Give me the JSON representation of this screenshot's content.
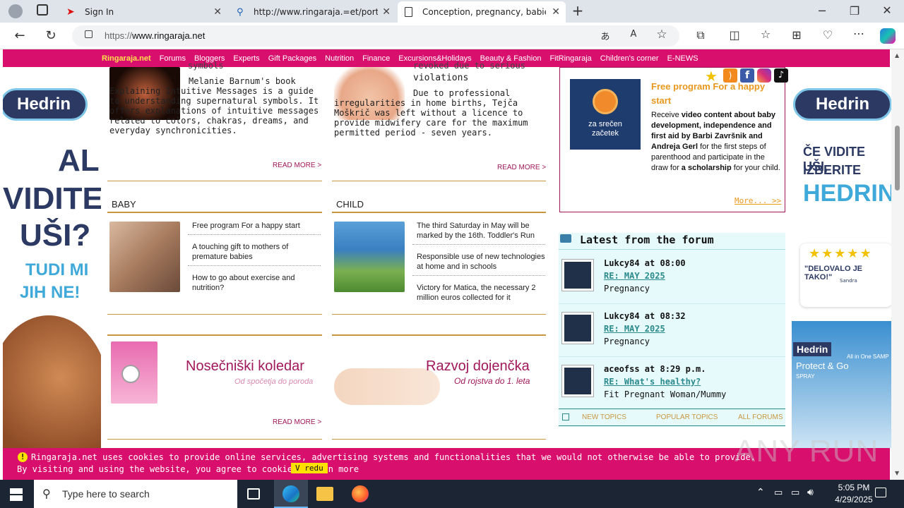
{
  "browser": {
    "tabs": [
      {
        "label": "Sign In",
        "icon": "red-bird-icon"
      },
      {
        "label": "http://www.ringaraja.=et/portlet",
        "icon": "search-icon"
      },
      {
        "label": "Conception, pregnancy, babies a",
        "icon": "page-icon"
      }
    ],
    "new_tab": "+",
    "url": "https://www.ringaraja.net",
    "url_prefix": "https://",
    "url_host": "www.ringaraja.net"
  },
  "nav": {
    "brand": "Ringaraja.net",
    "items": [
      "Forums",
      "Bloggers",
      "Experts",
      "Gift Packages",
      "Nutrition",
      "Finance",
      "Excursions&Holidays",
      "Beauty & Fashion",
      "FitRingaraja",
      "Children's corner",
      "E-NEWS"
    ]
  },
  "ad_left": {
    "brand": "Hedrin",
    "line1": "ALI",
    "line2": "VIDITE",
    "line3": "UŠI?",
    "line4": "TUDI MI",
    "line5": "JIH NE!"
  },
  "ad_right": {
    "brand": "Hedrin",
    "line1": "ČE VIDITE UŠI,",
    "line2": "IZBERITE",
    "line3": "HEDRIN",
    "quote": "\"DELOVALO JE TAKO!\"",
    "author": "Sandra",
    "stars": "★★★★★",
    "product": "Protect & Go",
    "product_sub": "SPRAY",
    "pack": "All in One SAMP"
  },
  "articles": {
    "a1": {
      "title_tail": "symbols",
      "body": "Melanie Barnum's book Explaining Intuitive Messages is a guide to understanding supernatural symbols. It offers explanations of intuitive messages related to colors, chakras, dreams, and everyday synchronicities.",
      "more": "READ MORE >"
    },
    "a2": {
      "title_tail": "violations",
      "title_partial": "revoked due to serious",
      "body": "Due to professional irregularities in home births, Tejča Moškrič was left without a licence to provide midwifery care for the maximum permitted period - seven years.",
      "more": "READ MORE >"
    }
  },
  "baby": {
    "heading": "BABY",
    "items": [
      "Free program For a happy start",
      "A touching gift to mothers of premature babies",
      "How to go about exercise and nutrition?"
    ]
  },
  "child": {
    "heading": "CHILD",
    "items": [
      "The third Saturday in May will be marked by the 16th. Toddler's Run",
      "Responsible use of new technologies at home and in schools",
      "Victory for Matica, the necessary 2 million euros collected for it"
    ]
  },
  "promo1": {
    "title": "Nosečniški koledar",
    "sub": "Od spočetja do poroda",
    "more": "READ MORE >"
  },
  "promo2": {
    "title": "Razvoj dojenčka",
    "sub": "Od rojstva do 1. leta"
  },
  "program_box": {
    "logo_line1": "za srečen",
    "logo_line2": "začetek",
    "title": "Free program For a happy start",
    "body_parts": [
      "Receive ",
      "video content about baby development, independence and first aid by Barbi Završnik and Andreja Gerl",
      " for the first steps of parenthood and participate in the draw for ",
      "a scholarship",
      " for your child."
    ],
    "more": "More... >>"
  },
  "forum": {
    "title": "Latest from the forum",
    "posts": [
      {
        "user": "Lukcy84 at 08:00",
        "link": "RE: MAY 2025",
        "cat": "Pregnancy"
      },
      {
        "user": "Lukcy84 at 08:32",
        "link": "RE: MAY 2025",
        "cat": "Pregnancy"
      },
      {
        "user": "aceofss at 8:29 p.m.",
        "link": "RE: What's healthy?",
        "cat": "Fit Pregnant Woman/Mummy"
      }
    ],
    "footer": [
      "NEW TOPICS",
      "POPULAR TOPICS",
      "ALL FORUMS"
    ]
  },
  "cookie": {
    "line1": "Ringaraja.net uses cookies to provide online services, advertising systems and functionalities that we would not otherwise be able to provide.",
    "line2": "By visiting and using the website, you agree to cookies. Learn more",
    "button": "V redu"
  },
  "taskbar": {
    "search_placeholder": "Type here to search",
    "time": "5:05 PM",
    "date": "4/29/2025"
  },
  "watermark": "ANY RUN",
  "colors": {
    "brand": "#d90f6e",
    "accent": "#c8963e",
    "forum_bg": "#e6fafc",
    "hedrin": "#2c3a63"
  }
}
